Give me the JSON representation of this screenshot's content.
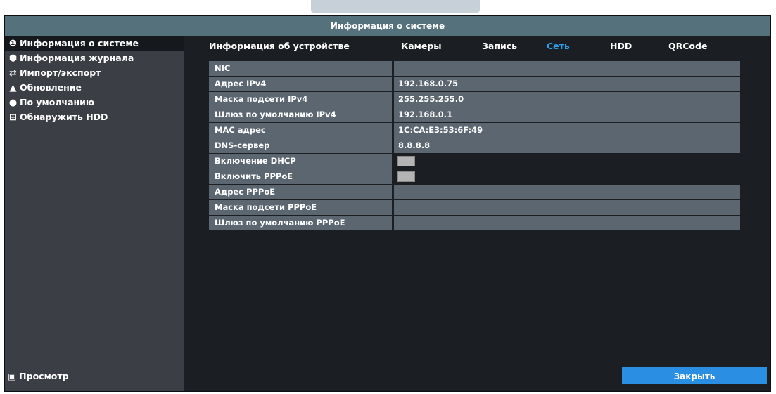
{
  "window": {
    "title": "Информация о системе"
  },
  "sidebar": {
    "items": [
      {
        "label": "Информация о системе",
        "icon": "info-icon",
        "active": true
      },
      {
        "label": "Информация журнала",
        "icon": "cube-icon",
        "active": false
      },
      {
        "label": "Импорт/экспорт",
        "icon": "transfer-icon",
        "active": false
      },
      {
        "label": "Обновление",
        "icon": "upgrade-icon",
        "active": false
      },
      {
        "label": "По умолчанию",
        "icon": "default-icon",
        "active": false
      },
      {
        "label": "Обнаружить HDD",
        "icon": "hdd-icon",
        "active": false
      }
    ],
    "bottom": {
      "label": "Просмотр",
      "icon": "camera-icon"
    }
  },
  "tabs": [
    {
      "label": "Информация об устройстве",
      "active": false
    },
    {
      "label": "Камеры",
      "active": false
    },
    {
      "label": "Запись",
      "active": false
    },
    {
      "label": "Сеть",
      "active": true
    },
    {
      "label": "HDD",
      "active": false
    },
    {
      "label": "QRCode",
      "active": false
    }
  ],
  "network": {
    "rows": [
      {
        "label": "NIC",
        "value": ""
      },
      {
        "label": "Адрес IPv4",
        "value": "192.168.0.75"
      },
      {
        "label": "Маска подсети IPv4",
        "value": "255.255.255.0"
      },
      {
        "label": "Шлюз по умолчанию IPv4",
        "value": "192.168.0.1"
      },
      {
        "label": "MAC адрес",
        "value": "1C:CA:E3:53:6F:49"
      },
      {
        "label": "DNS-сервер",
        "value": "8.8.8.8"
      },
      {
        "label": "Включение DHCP",
        "value": "",
        "checkbox": true
      },
      {
        "label": "Включить PPPoE",
        "value": "",
        "checkbox": true
      },
      {
        "label": "Адрес PPPoE",
        "value": ""
      },
      {
        "label": "Маска подсети PPPoE",
        "value": ""
      },
      {
        "label": "Шлюз по умолчанию PPPoE",
        "value": ""
      }
    ]
  },
  "buttons": {
    "close": "Закрыть"
  },
  "colors": {
    "accent": "#2a8fe3",
    "active_tab": "#2e9ee8",
    "titlebar": "#55717b",
    "cell": "#5b6670"
  }
}
